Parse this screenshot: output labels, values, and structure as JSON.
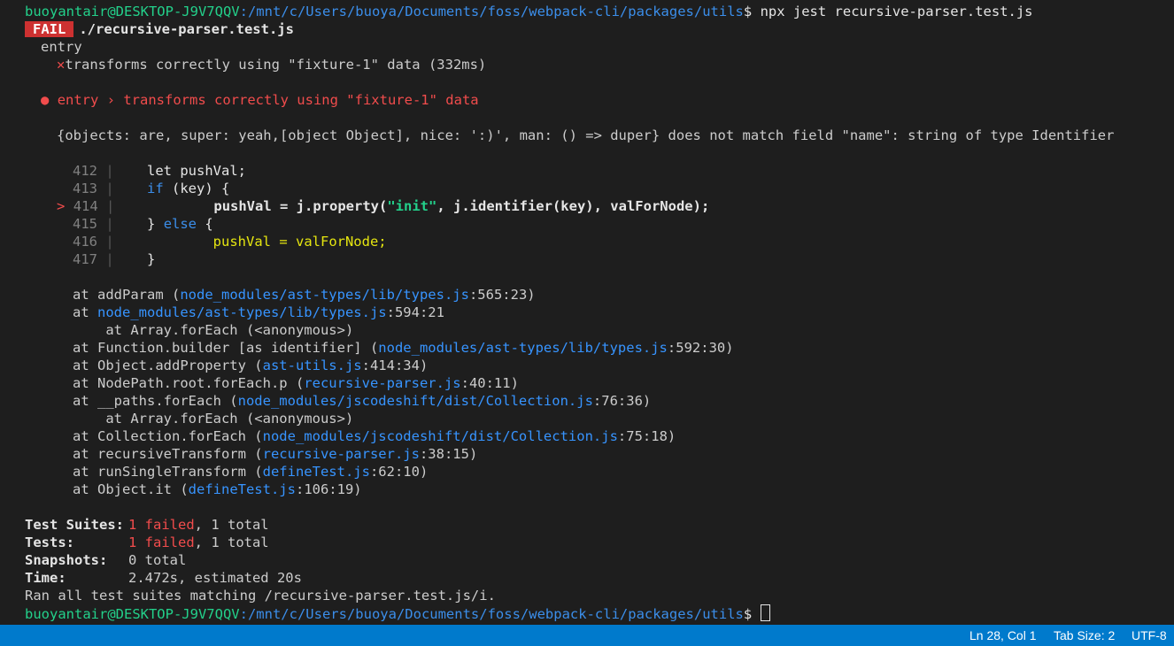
{
  "prompt": {
    "user": "buoyantair@DESKTOP-J9V7QQV",
    "path": ":/mnt/c/Users/buoya/Documents/foss/webpack-cli/packages/utils",
    "symbol": "$",
    "command": " npx jest recursive-parser.test.js"
  },
  "result": {
    "badge": "FAIL",
    "file": "./recursive-parser.test.js",
    "describe": "entry",
    "fail_mark": "✕",
    "test_line": "transforms correctly using \"fixture-1\" data (332ms)"
  },
  "failure": {
    "bullet": "●",
    "header": "entry › transforms correctly using \"fixture-1\" data",
    "message": "{objects: are, super: yeah,[object Object], nice: ':)', man: () => duper} does not match field \"name\": string of type Identifier"
  },
  "code_frame": {
    "marker": ">",
    "separator": "|",
    "lines": [
      {
        "num": "412",
        "prefix": "    ",
        "kw": "",
        "text": "let pushVal;"
      },
      {
        "num": "413",
        "prefix": "    ",
        "kw": "if",
        "text": " (key) {"
      },
      {
        "num": "414",
        "prefix": "            ",
        "kw": "",
        "text": "pushVal = j.property(",
        "str": "\"init\"",
        "rest": ", j.identifier(key), valForNode);"
      },
      {
        "num": "415",
        "prefix": "    ",
        "kw": "",
        "text": "} ",
        "kw2": "else",
        "rest": " {"
      },
      {
        "num": "416",
        "prefix": "            ",
        "kw": "",
        "text": "pushVal = valForNode;"
      },
      {
        "num": "417",
        "prefix": "    ",
        "kw": "",
        "text": "}"
      }
    ]
  },
  "stack": [
    {
      "indent": "",
      "fn": "at addParam (",
      "file": "node_modules/ast-types/lib/types.js",
      "loc": ":565:23)"
    },
    {
      "indent": "",
      "fn": "at ",
      "file": "node_modules/ast-types/lib/types.js",
      "loc": ":594:21"
    },
    {
      "indent": "    ",
      "fn": "at Array.forEach (<anonymous>)",
      "file": "",
      "loc": ""
    },
    {
      "indent": "",
      "fn": "at Function.builder [as identifier] (",
      "file": "node_modules/ast-types/lib/types.js",
      "loc": ":592:30)"
    },
    {
      "indent": "",
      "fn": "at Object.addProperty (",
      "file": "ast-utils.js",
      "loc": ":414:34)"
    },
    {
      "indent": "",
      "fn": "at NodePath.root.forEach.p (",
      "file": "recursive-parser.js",
      "loc": ":40:11)"
    },
    {
      "indent": "",
      "fn": "at __paths.forEach (",
      "file": "node_modules/jscodeshift/dist/Collection.js",
      "loc": ":76:36)"
    },
    {
      "indent": "    ",
      "fn": "at Array.forEach (<anonymous>)",
      "file": "",
      "loc": ""
    },
    {
      "indent": "",
      "fn": "at Collection.forEach (",
      "file": "node_modules/jscodeshift/dist/Collection.js",
      "loc": ":75:18)"
    },
    {
      "indent": "",
      "fn": "at recursiveTransform (",
      "file": "recursive-parser.js",
      "loc": ":38:15)"
    },
    {
      "indent": "",
      "fn": "at runSingleTransform (",
      "file": "defineTest.js",
      "loc": ":62:10)"
    },
    {
      "indent": "",
      "fn": "at Object.it (",
      "file": "defineTest.js",
      "loc": ":106:19)"
    }
  ],
  "summary": {
    "suites_label": "Test Suites:",
    "suites_failed": "1 failed",
    "suites_total": ", 1 total",
    "tests_label": "Tests:",
    "tests_failed": "1 failed",
    "tests_total": ", 1 total",
    "snapshots_label": "Snapshots:",
    "snapshots_value": "0 total",
    "time_label": "Time:",
    "time_value": "2.472s, estimated 20s",
    "ran_all": "Ran all test suites matching /recursive-parser.test.js/i."
  },
  "statusbar": {
    "position": "Ln 28, Col 1",
    "tab_size": "Tab Size: 2",
    "encoding": "UTF-8"
  }
}
